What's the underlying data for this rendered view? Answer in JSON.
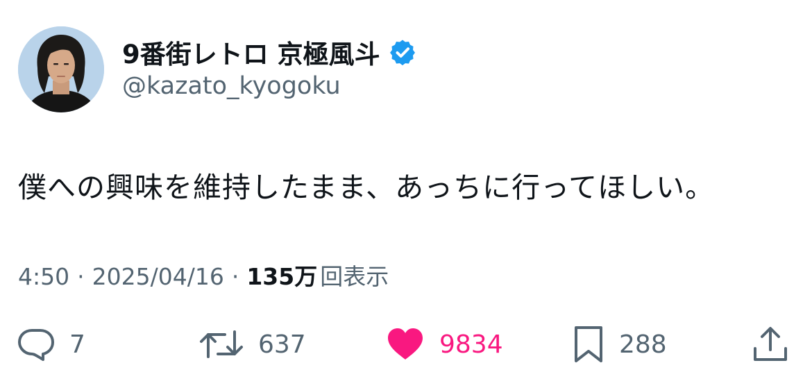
{
  "author": {
    "display_name": "9番街レトロ 京極風斗",
    "handle": "@kazato_kyogoku",
    "verified_icon": "verified-badge-icon",
    "badge_color": "#1d9bf0"
  },
  "tweet": {
    "text": "僕への興味を維持したまま、あっちに行ってほしい。"
  },
  "meta": {
    "time": "4:50",
    "separator": "·",
    "date": "2025/04/16",
    "views_count": "135万",
    "views_label": "回表示"
  },
  "actions": {
    "reply": {
      "icon": "reply-icon",
      "count": "7"
    },
    "retweet": {
      "icon": "retweet-icon",
      "count": "637"
    },
    "like": {
      "icon": "heart-icon",
      "count": "9834",
      "color": "#f91880"
    },
    "bookmark": {
      "icon": "bookmark-icon",
      "count": "288"
    },
    "share": {
      "icon": "share-icon"
    }
  }
}
